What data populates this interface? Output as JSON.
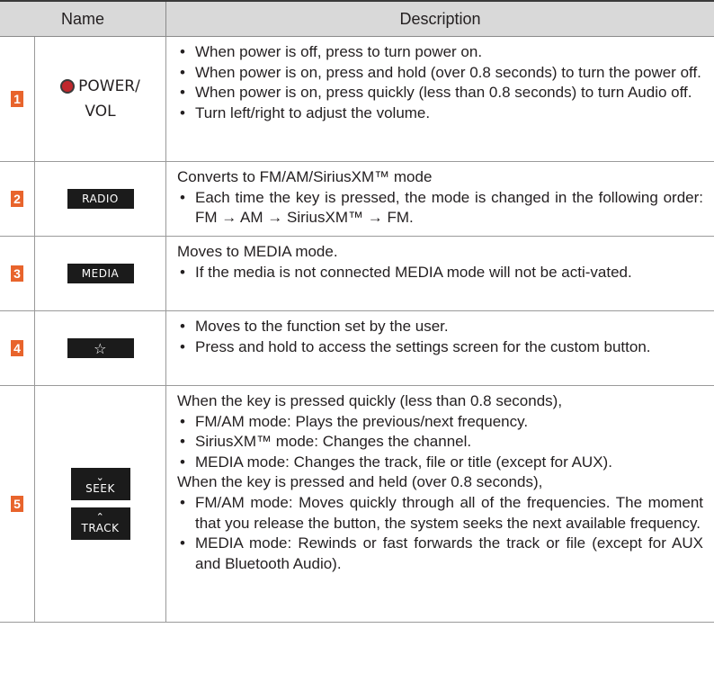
{
  "header": {
    "name": "Name",
    "description": "Description"
  },
  "rows": [
    {
      "num": "1",
      "button_label": "POWER/",
      "button_label2": "VOL",
      "icon": "power-knob-icon",
      "items": [
        "When power is off, press to turn power on.",
        "When power is on, press and hold (over 0.8 seconds) to turn the power off.",
        "When power is on, press quickly (less than 0.8 seconds) to turn Audio off.",
        "Turn left/right to adjust the volume."
      ]
    },
    {
      "num": "2",
      "button_label": "RADIO",
      "intro": "Converts to FM/AM/SiriusXM™ mode",
      "items": [
        "Each time the key is pressed, the mode is changed in the following order: FM → AM → SiriusXM™ → FM."
      ]
    },
    {
      "num": "3",
      "button_label": "MEDIA",
      "intro": "Moves to MEDIA mode.",
      "items": [
        "If the media is not connected MEDIA mode will not be acti-vated."
      ]
    },
    {
      "num": "4",
      "button_label": "☆",
      "icon": "star-icon",
      "items": [
        "Moves to the function set by the user.",
        "Press and hold to access the settings screen for the custom button."
      ]
    },
    {
      "num": "5",
      "seek_label": "SEEK",
      "track_label": "TRACK",
      "intro": "When the key is pressed quickly (less than 0.8 seconds),",
      "items": [
        "FM/AM mode: Plays the previous/next frequency.",
        "SiriusXM™ mode: Changes the channel.",
        "MEDIA mode: Changes the track, file or title (except for AUX)."
      ],
      "intro2": "When the key is pressed and held (over 0.8 seconds),",
      "items2": [
        "FM/AM mode: Moves quickly through all of the frequencies. The moment that you release the button, the system seeks the next available frequency.",
        "MEDIA mode: Rewinds or fast forwards the track or file (except for AUX and Bluetooth Audio)."
      ]
    }
  ]
}
